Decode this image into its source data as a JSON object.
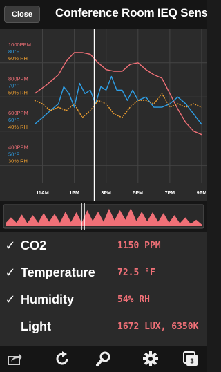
{
  "header": {
    "close_label": "Close",
    "title": "Conference Room IEQ Sens..."
  },
  "chart_data": {
    "type": "line",
    "x_ticks": [
      "11AM",
      "1PM",
      "3PM",
      "5PM",
      "7PM",
      "9PM"
    ],
    "x_range": [
      "10:30",
      "21:00"
    ],
    "cursor_time": "2:15PM",
    "y_labels": [
      {
        "co2": "1000PPM",
        "temp": "80°F",
        "rh": "60% RH"
      },
      {
        "co2": "800PPM",
        "temp": "70°F",
        "rh": "50% RH"
      },
      {
        "co2": "600PPM",
        "temp": "60°F",
        "rh": "40% RH"
      },
      {
        "co2": "400PPM",
        "temp": "50°F",
        "rh": "30% RH"
      }
    ],
    "ranges": {
      "co2": [
        300,
        1100
      ],
      "temperature": [
        45,
        85
      ],
      "humidity": [
        25,
        65
      ]
    },
    "colors": {
      "co2": "#f07077",
      "temperature": "#2e9fe6",
      "humidity": "#f0a030"
    },
    "series": [
      {
        "name": "CO2",
        "unit": "PPM",
        "x": [
          "10:30",
          "11:15",
          "12:00",
          "12:30",
          "13:00",
          "13:30",
          "14:00",
          "14:30",
          "15:00",
          "15:30",
          "16:00",
          "16:30",
          "17:00",
          "17:30",
          "18:00",
          "18:30",
          "19:00",
          "19:30",
          "20:00",
          "20:30",
          "21:00"
        ],
        "values": [
          820,
          870,
          930,
          1010,
          1060,
          1060,
          1050,
          1000,
          960,
          950,
          950,
          990,
          1000,
          960,
          930,
          910,
          820,
          730,
          650,
          600,
          580
        ]
      },
      {
        "name": "Temperature",
        "unit": "°F",
        "x": [
          "10:30",
          "11:00",
          "11:30",
          "12:00",
          "12:20",
          "12:40",
          "13:00",
          "13:20",
          "13:40",
          "14:00",
          "14:20",
          "14:40",
          "15:00",
          "15:20",
          "15:40",
          "16:00",
          "16:20",
          "16:40",
          "17:00",
          "17:30",
          "18:00",
          "18:30",
          "19:00",
          "19:30",
          "20:00",
          "20:30",
          "21:00"
        ],
        "values": [
          62,
          64,
          66,
          68,
          73,
          71,
          67,
          74,
          71,
          72,
          68,
          73,
          72,
          76,
          72,
          72,
          69,
          72,
          69,
          70,
          67,
          67,
          68,
          70,
          68,
          65,
          62
        ]
      },
      {
        "name": "Humidity",
        "unit": "% RH",
        "x": [
          "10:30",
          "11:00",
          "11:30",
          "12:00",
          "12:30",
          "13:00",
          "13:30",
          "14:00",
          "14:30",
          "15:00",
          "15:30",
          "16:00",
          "16:30",
          "17:00",
          "17:30",
          "18:00",
          "18:30",
          "19:00",
          "19:30",
          "20:00",
          "20:30",
          "21:00"
        ],
        "values": [
          49,
          48,
          46,
          47,
          46,
          48,
          44,
          46,
          49,
          48,
          45,
          44,
          47,
          49,
          49,
          48,
          51,
          47,
          48,
          47,
          48,
          47
        ]
      }
    ]
  },
  "overview": {
    "color": "#f07077",
    "values": [
      10,
      30,
      12,
      40,
      10,
      38,
      12,
      45,
      15,
      42,
      12,
      50,
      14,
      48,
      12,
      55,
      18,
      50,
      15,
      60,
      20,
      55,
      22,
      62,
      18,
      50,
      16,
      48,
      15,
      45,
      12,
      38,
      10,
      30,
      8,
      22,
      6
    ]
  },
  "metrics": [
    {
      "checked": true,
      "check_label": "✓",
      "label": "CO2",
      "value": "1150 PPM"
    },
    {
      "checked": true,
      "check_label": "✓",
      "label": "Temperature",
      "value": "72.5 °F"
    },
    {
      "checked": true,
      "check_label": "✓",
      "label": "Humidity",
      "value": "54% RH"
    },
    {
      "checked": false,
      "check_label": "",
      "label": "Light",
      "value": "1672 LUX, 6350K"
    }
  ],
  "toolbar": {
    "tabs_count": "3"
  }
}
